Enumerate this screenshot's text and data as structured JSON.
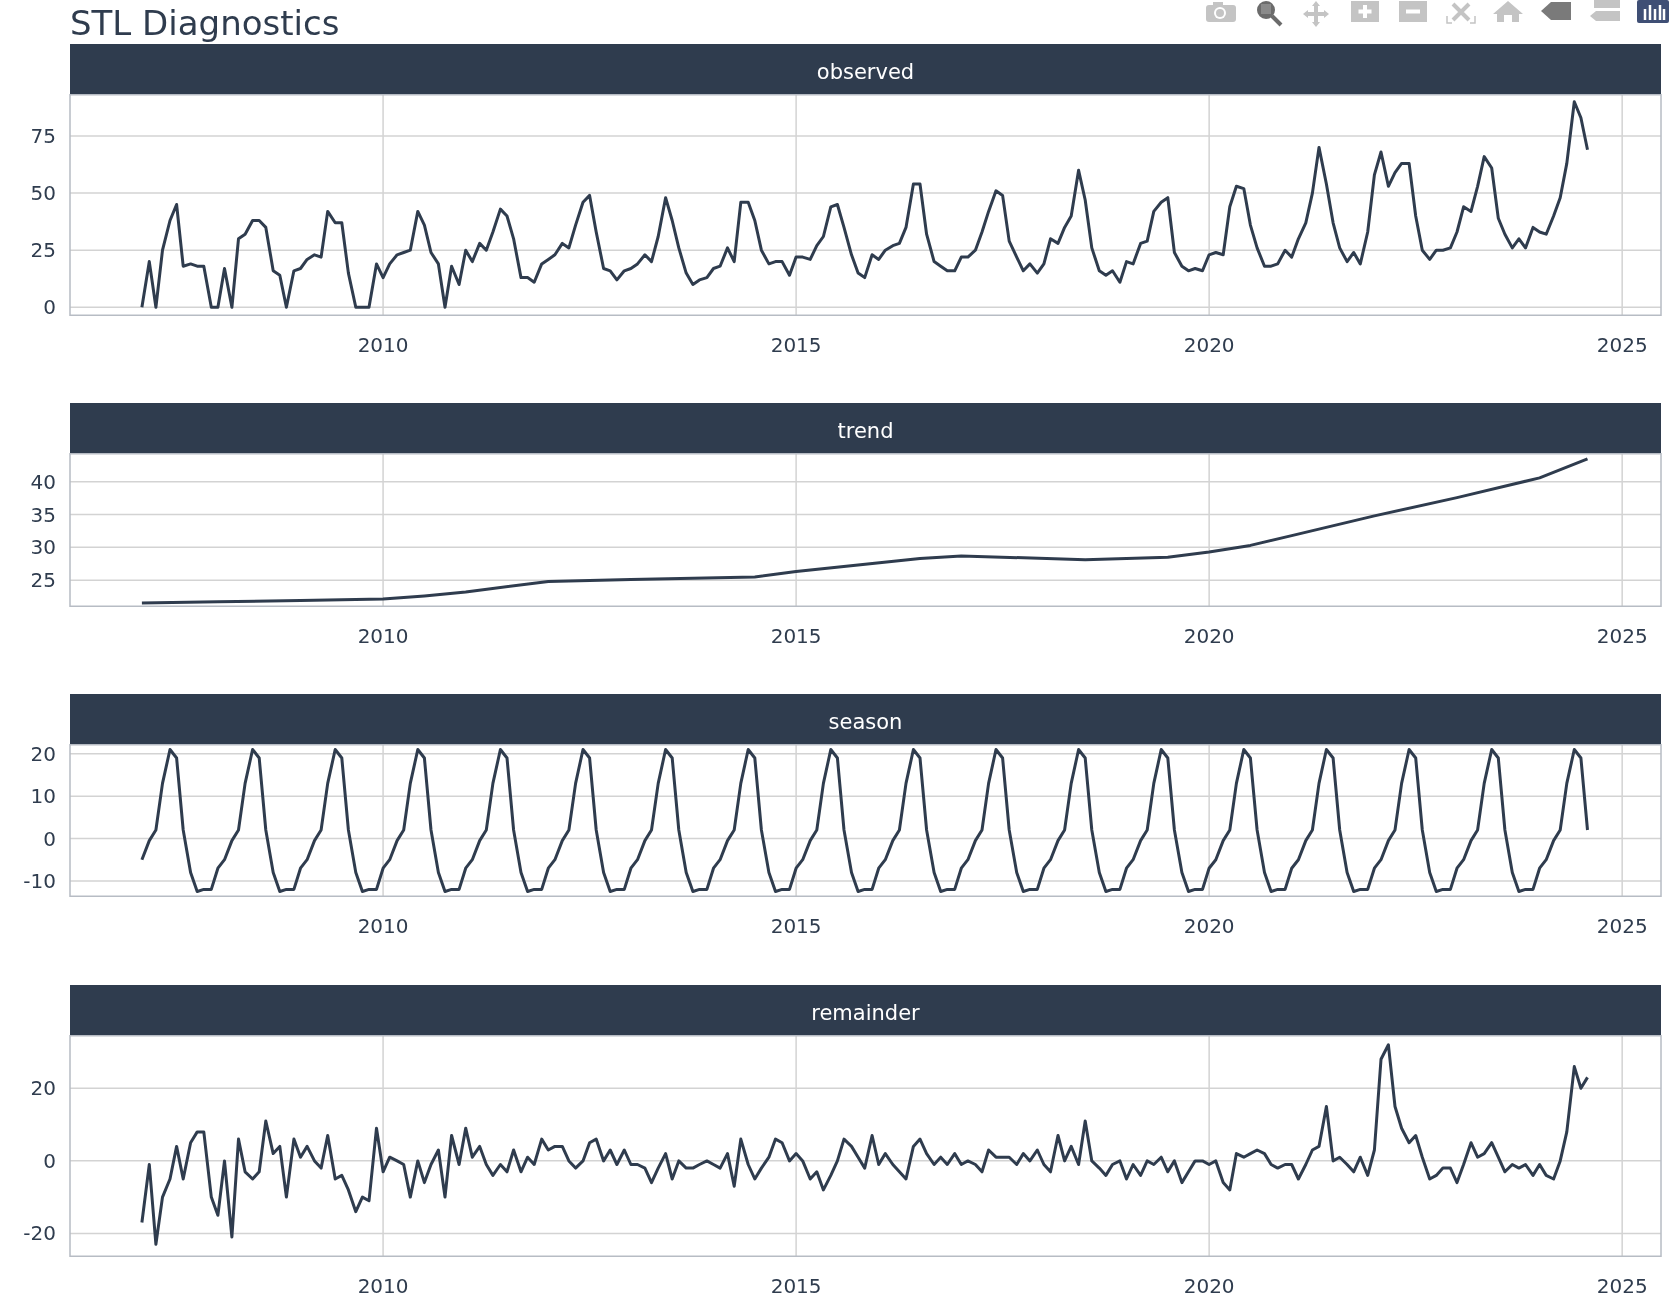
{
  "title": "STL Diagnostics",
  "panels": [
    {
      "chart_data": {
        "type": "line",
        "title": "observed",
        "grid": true,
        "xlim": [
          2006.21,
          2025.47
        ],
        "ylim": [
          -3.8,
          93.4
        ],
        "xticks": [
          2010,
          2015,
          2020,
          2025
        ],
        "yticks": [
          0,
          25,
          50,
          75
        ],
        "x": [
          2007.08,
          2007.17,
          2007.25,
          2007.33,
          2007.42,
          2007.5,
          2007.58,
          2007.67,
          2007.75,
          2007.83,
          2007.92,
          2008,
          2008.08,
          2008.17,
          2008.25,
          2008.33,
          2008.42,
          2008.5,
          2008.58,
          2008.67,
          2008.75,
          2008.83,
          2008.92,
          2009,
          2009.08,
          2009.17,
          2009.25,
          2009.33,
          2009.42,
          2009.5,
          2009.58,
          2009.67,
          2009.75,
          2009.83,
          2009.92,
          2010,
          2010.08,
          2010.17,
          2010.25,
          2010.33,
          2010.42,
          2010.5,
          2010.58,
          2010.67,
          2010.75,
          2010.83,
          2010.92,
          2011,
          2011.08,
          2011.17,
          2011.25,
          2011.33,
          2011.42,
          2011.5,
          2011.58,
          2011.67,
          2011.75,
          2011.83,
          2011.92,
          2012,
          2012.08,
          2012.17,
          2012.25,
          2012.33,
          2012.42,
          2012.5,
          2012.58,
          2012.67,
          2012.75,
          2012.83,
          2012.92,
          2013,
          2013.08,
          2013.17,
          2013.25,
          2013.33,
          2013.42,
          2013.5,
          2013.58,
          2013.67,
          2013.75,
          2013.83,
          2013.92,
          2014,
          2014.08,
          2014.17,
          2014.25,
          2014.33,
          2014.42,
          2014.5,
          2014.58,
          2014.67,
          2014.75,
          2014.83,
          2014.92,
          2015,
          2015.08,
          2015.17,
          2015.25,
          2015.33,
          2015.42,
          2015.5,
          2015.58,
          2015.67,
          2015.75,
          2015.83,
          2015.92,
          2016,
          2016.08,
          2016.17,
          2016.25,
          2016.33,
          2016.42,
          2016.5,
          2016.58,
          2016.67,
          2016.75,
          2016.83,
          2016.92,
          2017,
          2017.08,
          2017.17,
          2017.25,
          2017.33,
          2017.42,
          2017.5,
          2017.58,
          2017.67,
          2017.75,
          2017.83,
          2017.92,
          2018,
          2018.08,
          2018.17,
          2018.25,
          2018.33,
          2018.42,
          2018.5,
          2018.58,
          2018.67,
          2018.75,
          2018.83,
          2018.92,
          2019,
          2019.08,
          2019.17,
          2019.25,
          2019.33,
          2019.42,
          2019.5,
          2019.58,
          2019.67,
          2019.75,
          2019.83,
          2019.92,
          2020,
          2020.08,
          2020.17,
          2020.25,
          2020.33,
          2020.42,
          2020.5,
          2020.58,
          2020.67,
          2020.75,
          2020.83,
          2020.92,
          2021,
          2021.08,
          2021.17,
          2021.25,
          2021.33,
          2021.42,
          2021.5,
          2021.58,
          2021.67,
          2021.75,
          2021.83,
          2021.92,
          2022,
          2022.08,
          2022.17,
          2022.25,
          2022.33,
          2022.42,
          2022.5,
          2022.58,
          2022.67,
          2022.75,
          2022.83,
          2022.92,
          2023,
          2023.08,
          2023.17,
          2023.25,
          2023.33,
          2023.42,
          2023.5,
          2023.58,
          2023.67,
          2023.75,
          2023.83,
          2023.92,
          2024,
          2024.08,
          2024.17,
          2024.25,
          2024.33,
          2024.42,
          2024.5,
          2024.58
        ],
        "series": [
          {
            "color": "#2f3c4e",
            "values": [
              0,
              20,
              0,
              25,
              38,
              45,
              18,
              19,
              18,
              18,
              0,
              0,
              17,
              0,
              30,
              32,
              38,
              38,
              35,
              16,
              14,
              0,
              16,
              17,
              21,
              23,
              22,
              42,
              37,
              37,
              15,
              0,
              0,
              0,
              19,
              13,
              19,
              23,
              24,
              25,
              42,
              36,
              24,
              19,
              0,
              18,
              10,
              25,
              20,
              28,
              25,
              33,
              43,
              40,
              30,
              13,
              13,
              11,
              19,
              21,
              23,
              28,
              26,
              36,
              46,
              49,
              33,
              17,
              16,
              12,
              16,
              17,
              19,
              23,
              20,
              31,
              48,
              38,
              26,
              15,
              10,
              12,
              13,
              17,
              18,
              26,
              20,
              46,
              46,
              38,
              25,
              19,
              20,
              20,
              14,
              22,
              22,
              21,
              27,
              31,
              44,
              45,
              35,
              23,
              15,
              13,
              23,
              21,
              25,
              27,
              28,
              35,
              54,
              54,
              32,
              20,
              18,
              16,
              16,
              22,
              22,
              25,
              33,
              42,
              51,
              49,
              29,
              22,
              16,
              19,
              15,
              19,
              30,
              28,
              35,
              40,
              60,
              47,
              26,
              16,
              14,
              16,
              11,
              20,
              19,
              28,
              29,
              42,
              46,
              48,
              24,
              18,
              16,
              17,
              16,
              23,
              24,
              23,
              44,
              53,
              52,
              36,
              26,
              18,
              18,
              19,
              25,
              22,
              30,
              37,
              50,
              70,
              54,
              37,
              26,
              20,
              24,
              19,
              33,
              58,
              68,
              53,
              59,
              63,
              63,
              40,
              25,
              21,
              25,
              25,
              26,
              33,
              44,
              42,
              53,
              66,
              61,
              39,
              32,
              26,
              30,
              26,
              35,
              33,
              32,
              40,
              48,
              63,
              90,
              83,
              69
            ]
          }
        ]
      }
    },
    {
      "chart_data": {
        "type": "line",
        "title": "trend",
        "grid": true,
        "xlim": [
          2006.21,
          2025.47
        ],
        "ylim": [
          20.9,
          44.4
        ],
        "xticks": [
          2010,
          2015,
          2020,
          2025
        ],
        "yticks": [
          25,
          30,
          35,
          40
        ],
        "x": [
          2007.08,
          2008,
          2009,
          2010,
          2010.5,
          2011,
          2012,
          2013,
          2014.5,
          2015,
          2016.5,
          2017,
          2018.5,
          2019.5,
          2020,
          2020.5,
          2021,
          2022,
          2023,
          2024,
          2024.58
        ],
        "series": [
          {
            "color": "#2f3c4e",
            "values": [
              21.5,
              21.7,
              21.9,
              22.1,
              22.6,
              23.2,
              24.8,
              25.1,
              25.5,
              26.3,
              28.3,
              28.7,
              28.1,
              28.5,
              29.3,
              30.3,
              31.8,
              34.8,
              37.6,
              40.6,
              43.5
            ]
          }
        ]
      }
    },
    {
      "chart_data": {
        "type": "line",
        "title": "season",
        "grid": true,
        "xlim": [
          2006.21,
          2025.47
        ],
        "ylim": [
          -13.8,
          22.3
        ],
        "xticks": [
          2010,
          2015,
          2020,
          2025
        ],
        "yticks": [
          -10,
          0,
          10,
          20
        ],
        "x": [
          2007.08,
          2007.17,
          2007.25,
          2007.33,
          2007.42,
          2007.5,
          2007.58,
          2007.67,
          2007.75,
          2007.83,
          2007.92,
          2008,
          2008.08,
          2008.17,
          2008.25,
          2008.33,
          2008.42,
          2008.5,
          2008.58,
          2008.67,
          2008.75,
          2008.83,
          2008.92,
          2009,
          2009.08,
          2009.17,
          2009.25,
          2009.33,
          2009.42,
          2009.5,
          2009.58,
          2009.67,
          2009.75,
          2009.83,
          2009.92,
          2010,
          2010.08,
          2010.17,
          2010.25,
          2010.33,
          2010.42,
          2010.5,
          2010.58,
          2010.67,
          2010.75,
          2010.83,
          2010.92,
          2011,
          2011.08,
          2011.17,
          2011.25,
          2011.33,
          2011.42,
          2011.5,
          2011.58,
          2011.67,
          2011.75,
          2011.83,
          2011.92,
          2012,
          2012.08,
          2012.17,
          2012.25,
          2012.33,
          2012.42,
          2012.5,
          2012.58,
          2012.67,
          2012.75,
          2012.83,
          2012.92,
          2013,
          2013.08,
          2013.17,
          2013.25,
          2013.33,
          2013.42,
          2013.5,
          2013.58,
          2013.67,
          2013.75,
          2013.83,
          2013.92,
          2014,
          2014.08,
          2014.17,
          2014.25,
          2014.33,
          2014.42,
          2014.5,
          2014.58,
          2014.67,
          2014.75,
          2014.83,
          2014.92,
          2015,
          2015.08,
          2015.17,
          2015.25,
          2015.33,
          2015.42,
          2015.5,
          2015.58,
          2015.67,
          2015.75,
          2015.83,
          2015.92,
          2016,
          2016.08,
          2016.17,
          2016.25,
          2016.33,
          2016.42,
          2016.5,
          2016.58,
          2016.67,
          2016.75,
          2016.83,
          2016.92,
          2017,
          2017.08,
          2017.17,
          2017.25,
          2017.33,
          2017.42,
          2017.5,
          2017.58,
          2017.67,
          2017.75,
          2017.83,
          2017.92,
          2018,
          2018.08,
          2018.17,
          2018.25,
          2018.33,
          2018.42,
          2018.5,
          2018.58,
          2018.67,
          2018.75,
          2018.83,
          2018.92,
          2019,
          2019.08,
          2019.17,
          2019.25,
          2019.33,
          2019.42,
          2019.5,
          2019.58,
          2019.67,
          2019.75,
          2019.83,
          2019.92,
          2020,
          2020.08,
          2020.17,
          2020.25,
          2020.33,
          2020.42,
          2020.5,
          2020.58,
          2020.67,
          2020.75,
          2020.83,
          2020.92,
          2021,
          2021.08,
          2021.17,
          2021.25,
          2021.33,
          2021.42,
          2021.5,
          2021.58,
          2021.67,
          2021.75,
          2021.83,
          2021.92,
          2022,
          2022.08,
          2022.17,
          2022.25,
          2022.33,
          2022.42,
          2022.5,
          2022.58,
          2022.67,
          2022.75,
          2022.83,
          2022.92,
          2023,
          2023.08,
          2023.17,
          2023.25,
          2023.33,
          2023.42,
          2023.5,
          2023.58,
          2023.67,
          2023.75,
          2023.83,
          2023.92,
          2024,
          2024.08,
          2024.17,
          2024.25,
          2024.33,
          2024.42,
          2024.5,
          2024.58
        ],
        "series": [
          {
            "color": "#2f3c4e",
            "values": [
              -5,
              -0.5,
              2,
              13,
              21,
              19,
              2,
              -8,
              -12.5,
              -12,
              -12,
              -7,
              -5,
              -0.5,
              2,
              13,
              21,
              19,
              2,
              -8,
              -12.5,
              -12,
              -12,
              -7,
              -5,
              -0.5,
              2,
              13,
              21,
              19,
              2,
              -8,
              -12.5,
              -12,
              -12,
              -7,
              -5,
              -0.5,
              2,
              13,
              21,
              19,
              2,
              -8,
              -12.5,
              -12,
              -12,
              -7,
              -5,
              -0.5,
              2,
              13,
              21,
              19,
              2,
              -8,
              -12.5,
              -12,
              -12,
              -7,
              -5,
              -0.5,
              2,
              13,
              21,
              19,
              2,
              -8,
              -12.5,
              -12,
              -12,
              -7,
              -5,
              -0.5,
              2,
              13,
              21,
              19,
              2,
              -8,
              -12.5,
              -12,
              -12,
              -7,
              -5,
              -0.5,
              2,
              13,
              21,
              19,
              2,
              -8,
              -12.5,
              -12,
              -12,
              -7,
              -5,
              -0.5,
              2,
              13,
              21,
              19,
              2,
              -8,
              -12.5,
              -12,
              -12,
              -7,
              -5,
              -0.5,
              2,
              13,
              21,
              19,
              2,
              -8,
              -12.5,
              -12,
              -12,
              -7,
              -5,
              -0.5,
              2,
              13,
              21,
              19,
              2,
              -8,
              -12.5,
              -12,
              -12,
              -7,
              -5,
              -0.5,
              2,
              13,
              21,
              19,
              2,
              -8,
              -12.5,
              -12,
              -12,
              -7,
              -5,
              -0.5,
              2,
              13,
              21,
              19,
              2,
              -8,
              -12.5,
              -12,
              -12,
              -7,
              -5,
              -0.5,
              2,
              13,
              21,
              19,
              2,
              -8,
              -12.5,
              -12,
              -12,
              -7,
              -5,
              -0.5,
              2,
              13,
              21,
              19,
              2,
              -8,
              -12.5,
              -12,
              -12,
              -7,
              -5,
              -0.5,
              2,
              13,
              21,
              19,
              2,
              -8,
              -12.5,
              -12,
              -12,
              -7,
              -5,
              -0.5,
              2,
              13,
              21,
              19,
              2,
              -8,
              -12.5,
              -12,
              -12,
              -7,
              -5,
              -0.5,
              2,
              13,
              21,
              19,
              2
            ]
          }
        ]
      }
    },
    {
      "chart_data": {
        "type": "line",
        "title": "remainder",
        "grid": true,
        "xlim": [
          2006.21,
          2025.47
        ],
        "ylim": [
          -26.5,
          34.7
        ],
        "xticks": [
          2010,
          2015,
          2020,
          2025
        ],
        "yticks": [
          -20,
          0,
          20
        ],
        "x": [
          2007.08,
          2007.17,
          2007.25,
          2007.33,
          2007.42,
          2007.5,
          2007.58,
          2007.67,
          2007.75,
          2007.83,
          2007.92,
          2008,
          2008.08,
          2008.17,
          2008.25,
          2008.33,
          2008.42,
          2008.5,
          2008.58,
          2008.67,
          2008.75,
          2008.83,
          2008.92,
          2009,
          2009.08,
          2009.17,
          2009.25,
          2009.33,
          2009.42,
          2009.5,
          2009.58,
          2009.67,
          2009.75,
          2009.83,
          2009.92,
          2010,
          2010.08,
          2010.17,
          2010.25,
          2010.33,
          2010.42,
          2010.5,
          2010.58,
          2010.67,
          2010.75,
          2010.83,
          2010.92,
          2011,
          2011.08,
          2011.17,
          2011.25,
          2011.33,
          2011.42,
          2011.5,
          2011.58,
          2011.67,
          2011.75,
          2011.83,
          2011.92,
          2012,
          2012.08,
          2012.17,
          2012.25,
          2012.33,
          2012.42,
          2012.5,
          2012.58,
          2012.67,
          2012.75,
          2012.83,
          2012.92,
          2013,
          2013.08,
          2013.17,
          2013.25,
          2013.33,
          2013.42,
          2013.5,
          2013.58,
          2013.67,
          2013.75,
          2013.83,
          2013.92,
          2014,
          2014.08,
          2014.17,
          2014.25,
          2014.33,
          2014.42,
          2014.5,
          2014.58,
          2014.67,
          2014.75,
          2014.83,
          2014.92,
          2015,
          2015.08,
          2015.17,
          2015.25,
          2015.33,
          2015.42,
          2015.5,
          2015.58,
          2015.67,
          2015.75,
          2015.83,
          2015.92,
          2016,
          2016.08,
          2016.17,
          2016.25,
          2016.33,
          2016.42,
          2016.5,
          2016.58,
          2016.67,
          2016.75,
          2016.83,
          2016.92,
          2017,
          2017.08,
          2017.17,
          2017.25,
          2017.33,
          2017.42,
          2017.5,
          2017.58,
          2017.67,
          2017.75,
          2017.83,
          2017.92,
          2018,
          2018.08,
          2018.17,
          2018.25,
          2018.33,
          2018.42,
          2018.5,
          2018.58,
          2018.67,
          2018.75,
          2018.83,
          2018.92,
          2019,
          2019.08,
          2019.17,
          2019.25,
          2019.33,
          2019.42,
          2019.5,
          2019.58,
          2019.67,
          2019.75,
          2019.83,
          2019.92,
          2020,
          2020.08,
          2020.17,
          2020.25,
          2020.33,
          2020.42,
          2020.5,
          2020.58,
          2020.67,
          2020.75,
          2020.83,
          2020.92,
          2021,
          2021.08,
          2021.17,
          2021.25,
          2021.33,
          2021.42,
          2021.5,
          2021.58,
          2021.67,
          2021.75,
          2021.83,
          2021.92,
          2022,
          2022.08,
          2022.17,
          2022.25,
          2022.33,
          2022.42,
          2022.5,
          2022.58,
          2022.67,
          2022.75,
          2022.83,
          2022.92,
          2023,
          2023.08,
          2023.17,
          2023.25,
          2023.33,
          2023.42,
          2023.5,
          2023.58,
          2023.67,
          2023.75,
          2023.83,
          2023.92,
          2024,
          2024.08,
          2024.17,
          2024.25,
          2024.33,
          2024.42,
          2024.5,
          2024.58
        ],
        "series": [
          {
            "color": "#2f3c4e",
            "values": [
              -17,
              -1,
              -23,
              -10,
              -5,
              4,
              -5,
              5,
              8,
              8,
              -10,
              -15,
              0,
              -21,
              6,
              -3,
              -5,
              -3,
              11,
              2,
              4,
              -10,
              6,
              1,
              4,
              0,
              -2,
              7,
              -5,
              -4,
              -8,
              -14,
              -10,
              -11,
              9,
              -3,
              1,
              0,
              -1,
              -10,
              0,
              -6,
              -1,
              3,
              -10,
              7,
              -1,
              9,
              1,
              4,
              -1,
              -4,
              -1,
              -3,
              3,
              -3,
              1,
              -1,
              6,
              3,
              4,
              4,
              0,
              -2,
              0,
              5,
              6,
              0,
              3,
              -1,
              3,
              -1,
              -1,
              -2,
              -6,
              -2,
              2,
              -5,
              0,
              -2,
              -2,
              -1,
              0,
              -1,
              -2,
              2,
              -7,
              6,
              -1,
              -5,
              -2,
              1,
              6,
              5,
              0,
              2,
              0,
              -5,
              -3,
              -8,
              -4,
              0,
              6,
              4,
              1,
              -2,
              7,
              -1,
              2,
              -1,
              -3,
              -5,
              4,
              6,
              2,
              -1,
              1,
              -1,
              2,
              -1,
              0,
              -1,
              -3,
              3,
              1,
              1,
              1,
              -1,
              2,
              0,
              3,
              -1,
              -3,
              7,
              0,
              4,
              -1,
              11,
              0,
              -2,
              -4,
              -1,
              0,
              -5,
              -1,
              -4,
              0,
              -1,
              1,
              -3,
              0,
              -6,
              -3,
              0,
              0,
              -1,
              0,
              -6,
              -8,
              2,
              1,
              2,
              3,
              2,
              -1,
              -2,
              -1,
              -1,
              -5,
              -1,
              3,
              4,
              15,
              0,
              1,
              -1,
              -3,
              1,
              -4,
              3,
              28,
              32,
              15,
              9,
              5,
              7,
              1,
              -5,
              -4,
              -2,
              -2,
              -6,
              -1,
              5,
              1,
              2,
              5,
              1,
              -3,
              -1,
              -2,
              -1,
              -4,
              -1,
              -4,
              -5,
              0,
              8,
              26,
              20,
              23
            ]
          }
        ]
      }
    }
  ]
}
